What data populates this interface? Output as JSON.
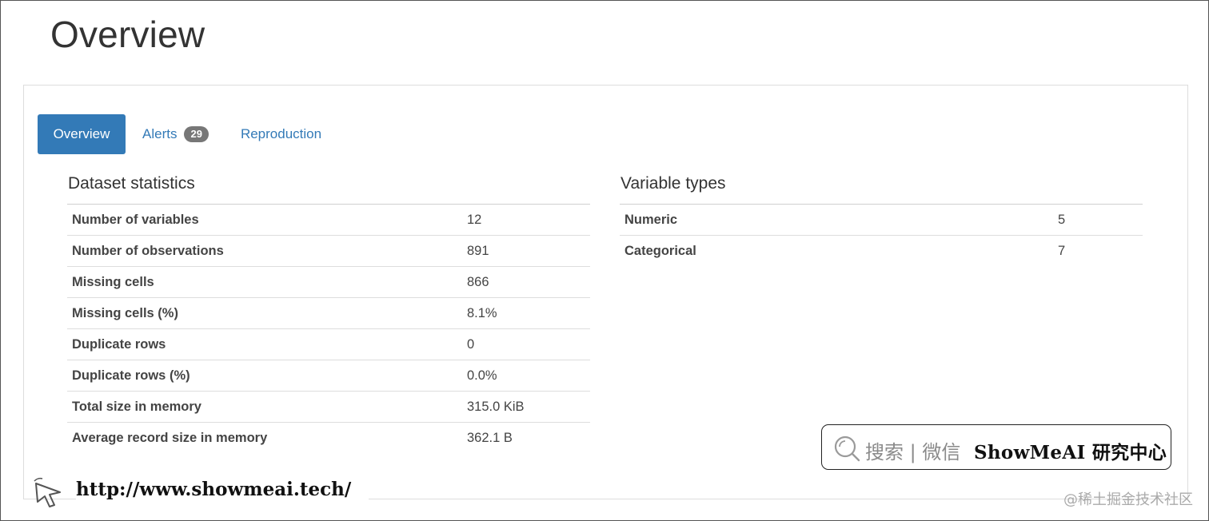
{
  "page": {
    "title": "Overview"
  },
  "tabs": [
    {
      "label": "Overview",
      "active": true
    },
    {
      "label": "Alerts",
      "badge": "29"
    },
    {
      "label": "Reproduction"
    }
  ],
  "dataset_statistics": {
    "title": "Dataset statistics",
    "rows": [
      {
        "label": "Number of variables",
        "value": "12"
      },
      {
        "label": "Number of observations",
        "value": "891"
      },
      {
        "label": "Missing cells",
        "value": "866"
      },
      {
        "label": "Missing cells (%)",
        "value": "8.1%"
      },
      {
        "label": "Duplicate rows",
        "value": "0"
      },
      {
        "label": "Duplicate rows (%)",
        "value": "0.0%"
      },
      {
        "label": "Total size in memory",
        "value": "315.0 KiB"
      },
      {
        "label": "Average record size in memory",
        "value": "362.1 B"
      }
    ]
  },
  "variable_types": {
    "title": "Variable types",
    "rows": [
      {
        "label": "Numeric",
        "value": "5"
      },
      {
        "label": "Categorical",
        "value": "7"
      }
    ]
  },
  "overlay": {
    "search_text": "搜索 | 微信",
    "brand_text": "ShowMeAI 研究中心",
    "url": "http://www.showmeai.tech/",
    "watermark": "@稀土掘金技术社区"
  },
  "colors": {
    "accent": "#337ab7",
    "badge": "#777777",
    "border": "#dddddd"
  },
  "icons": {
    "search": "search-icon",
    "cursor": "cursor-arrow-icon"
  }
}
